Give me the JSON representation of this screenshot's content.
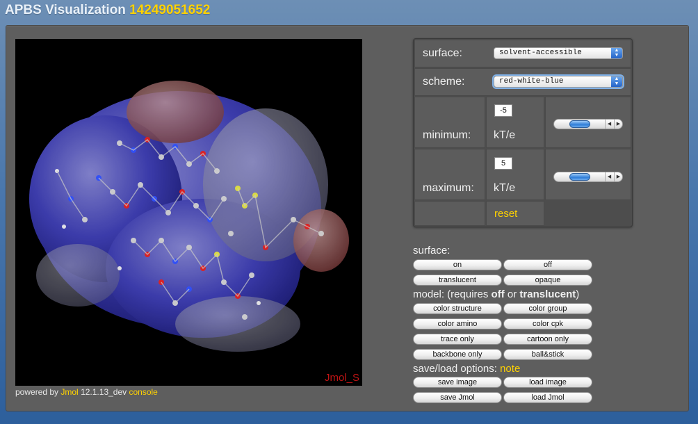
{
  "header": {
    "title_prefix": "APBS Visualization",
    "title_id": "14249051652",
    "accent_color": "#ffd200"
  },
  "viewer": {
    "watermark": "Jmol_S",
    "powered_by_text": "powered by",
    "jmol_link": "Jmol",
    "version": "12.1.13_dev",
    "console_link": "console"
  },
  "controls": {
    "surface_label": "surface:",
    "surface_value": "solvent-accessible",
    "scheme_label": "scheme:",
    "scheme_value": "red-white-blue",
    "minimum_label": "minimum:",
    "minimum_value": "-5",
    "minimum_unit": "kT/e",
    "maximum_label": "maximum:",
    "maximum_value": "5",
    "maximum_unit": "kT/e",
    "reset_link": "reset"
  },
  "surface_section": {
    "label": "surface:",
    "on": "on",
    "off": "off",
    "translucent": "translucent",
    "opaque": "opaque"
  },
  "model_section": {
    "label_prefix": "model: (requires ",
    "label_off": "off",
    "label_or": " or ",
    "label_translucent": "translucent",
    "label_suffix": ")",
    "color_structure": "color structure",
    "color_group": "color group",
    "color_amino": "color amino",
    "color_cpk": "color cpk",
    "trace_only": "trace only",
    "cartoon_only": "cartoon only",
    "backbone_only": "backbone only",
    "ball_stick": "ball&stick"
  },
  "saveload_section": {
    "label": "save/load options:",
    "note_link": "note",
    "save_image": "save image",
    "load_image": "load image",
    "save_jmol": "save Jmol",
    "load_jmol": "load Jmol"
  }
}
